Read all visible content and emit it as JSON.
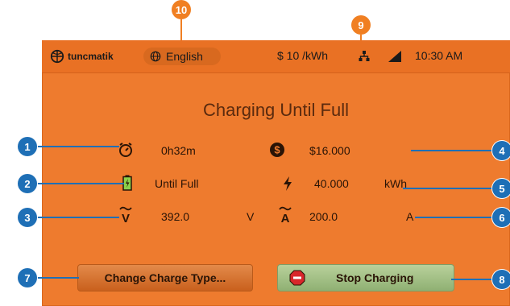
{
  "status_bar": {
    "brand": "tuncmatik",
    "language": "English",
    "price": "$ 10 /kWh",
    "time": "10:30 AM"
  },
  "main": {
    "title": "Charging Until Full",
    "duration": "0h32m",
    "cost": "$16.000",
    "mode": "Until Full",
    "energy_value": "40.000",
    "energy_unit": "kWh",
    "voltage_value": "392.0",
    "voltage_unit": "V",
    "current_value": "200.0",
    "current_unit": "A"
  },
  "buttons": {
    "change_label": "Change Charge Type...",
    "stop_label": "Stop Charging"
  },
  "callouts": {
    "c1": "1",
    "c2": "2",
    "c3": "3",
    "c4": "4",
    "c5": "5",
    "c6": "6",
    "c7": "7",
    "c8": "8",
    "c9": "9",
    "c10": "10"
  },
  "colors": {
    "screen_bg": "#ee7b2e",
    "status_bg": "#e97124",
    "stop_button": "#a6c287",
    "callout_blue": "#1e6fb6",
    "callout_orange": "#f07f22"
  }
}
